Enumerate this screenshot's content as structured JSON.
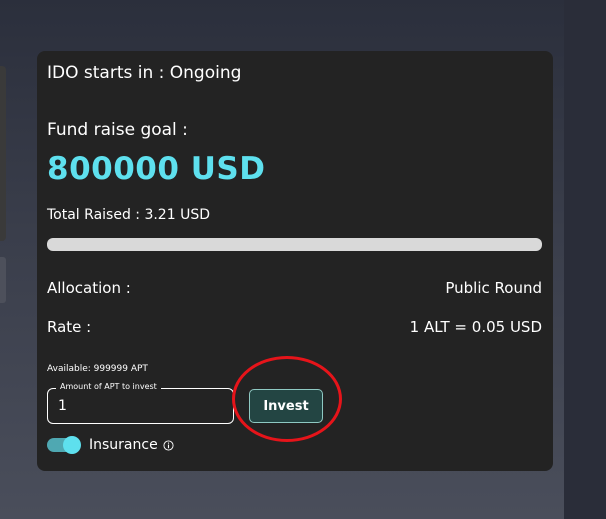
{
  "card": {
    "ido_status": "IDO starts in : Ongoing",
    "goal_label": "Fund raise goal :",
    "goal_value": "800000 USD",
    "total_raised": "Total Raised : 3.21 USD",
    "progress_fraction": 0.0,
    "allocation_label": "Allocation :",
    "allocation_value": "Public Round",
    "rate_label": "Rate :",
    "rate_value": "1 ALT = 0.05 USD",
    "available": "Available: 999999 APT",
    "amount_field_label": "Amount of APT to invest",
    "amount_value": "1",
    "invest_label": "Invest",
    "insurance_label": "Insurance",
    "insurance_enabled": true,
    "info_icon": "info-icon"
  },
  "colors": {
    "accent": "#5ee0ee",
    "card_bg": "#232323",
    "invest_bg": "#234543",
    "annotation": "#e6141a"
  }
}
